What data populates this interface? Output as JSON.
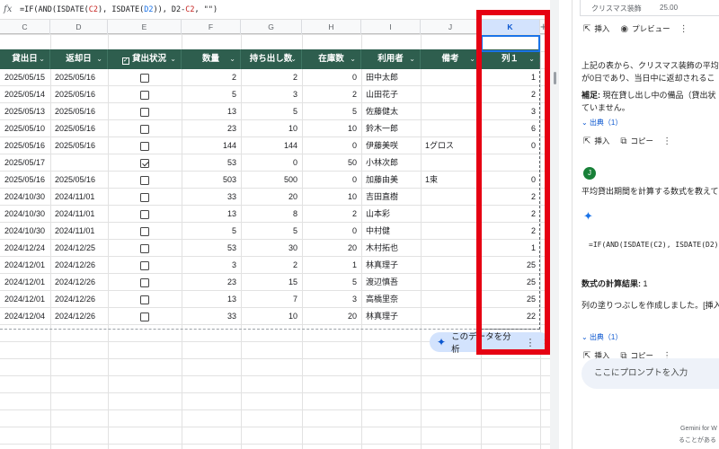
{
  "formula_bar": {
    "icon": "fx",
    "parts": [
      "=IF(AND(ISDATE(",
      "C2",
      "), ISDATE(",
      "D2",
      ")), D2-",
      "C2",
      ", \"\")"
    ]
  },
  "column_letters": [
    "C",
    "D",
    "E",
    "F",
    "G",
    "H",
    "I",
    "J",
    "K"
  ],
  "selected_column": "K",
  "table": {
    "headers": [
      "貸出日",
      "返却日",
      "貸出状況",
      "数量",
      "持ち出し数",
      "在庫数",
      "利用者",
      "備考",
      "列１"
    ],
    "rows": [
      [
        "2025/05/15",
        "2025/05/16",
        false,
        "2",
        "2",
        "0",
        "田中太郎",
        "",
        "1"
      ],
      [
        "2025/05/14",
        "2025/05/16",
        false,
        "5",
        "3",
        "2",
        "山田花子",
        "",
        "2"
      ],
      [
        "2025/05/13",
        "2025/05/16",
        false,
        "13",
        "5",
        "5",
        "佐藤健太",
        "",
        "3"
      ],
      [
        "2025/05/10",
        "2025/05/16",
        false,
        "23",
        "10",
        "10",
        "鈴木一郎",
        "",
        "6"
      ],
      [
        "2025/05/16",
        "2025/05/16",
        false,
        "144",
        "144",
        "0",
        "伊藤美咲",
        "1グロス",
        "0"
      ],
      [
        "2025/05/17",
        "",
        true,
        "53",
        "0",
        "50",
        "小林次郎",
        "",
        ""
      ],
      [
        "2025/05/16",
        "2025/05/16",
        false,
        "503",
        "500",
        "0",
        "加藤由美",
        "1束",
        "0"
      ],
      [
        "2024/10/30",
        "2024/11/01",
        false,
        "33",
        "20",
        "10",
        "吉田直樹",
        "",
        "2"
      ],
      [
        "2024/10/30",
        "2024/11/01",
        false,
        "13",
        "8",
        "2",
        "山本彩",
        "",
        "2"
      ],
      [
        "2024/10/30",
        "2024/11/01",
        false,
        "5",
        "5",
        "0",
        "中村健",
        "",
        "2"
      ],
      [
        "2024/12/24",
        "2024/12/25",
        false,
        "53",
        "30",
        "20",
        "木村拓也",
        "",
        "1"
      ],
      [
        "2024/12/01",
        "2024/12/26",
        false,
        "3",
        "2",
        "1",
        "林真理子",
        "",
        "25"
      ],
      [
        "2024/12/01",
        "2024/12/26",
        false,
        "23",
        "15",
        "5",
        "渡辺慎吾",
        "",
        "25"
      ],
      [
        "2024/12/01",
        "2024/12/26",
        false,
        "13",
        "7",
        "3",
        "高橋里奈",
        "",
        "25"
      ],
      [
        "2024/12/04",
        "2024/12/26",
        false,
        "33",
        "10",
        "20",
        "林真理子",
        "",
        "22"
      ]
    ]
  },
  "analyze_chip": {
    "label": "このデータを分析"
  },
  "panel": {
    "mini_table_cells": [
      "クリスマス装飾",
      "25.00"
    ],
    "insert_label": "挿入",
    "preview_label": "プレビュー",
    "copy_label": "コピー",
    "source_label": "出典（1）",
    "text1_line1": "上記の表から、クリスマス装飾の平均",
    "text1_line2": "が0日であり、当日中に返却されるこ",
    "note_bold": "補足:",
    "note_line1": " 現在貸し出し中の備品（貸出状",
    "note_line2": "ていません。",
    "user_initial": "J",
    "user_question": "平均貸出期間を計算する数式を教えて",
    "formula_snippet": "=IF(AND(ISDATE(C2), ISDATE(D2)",
    "result_label": "数式の計算結果:",
    "result_value": " 1",
    "result_text": "列の塗りつぶしを作成しました。[挿入",
    "prompt_placeholder": "ここにプロンプトを入力",
    "footer_line1": "Gemini for W",
    "footer_line2": "ることがある"
  },
  "colors": {
    "header_bg": "#2e5e4e",
    "highlight": "#e60012",
    "accent": "#1a73e8"
  }
}
